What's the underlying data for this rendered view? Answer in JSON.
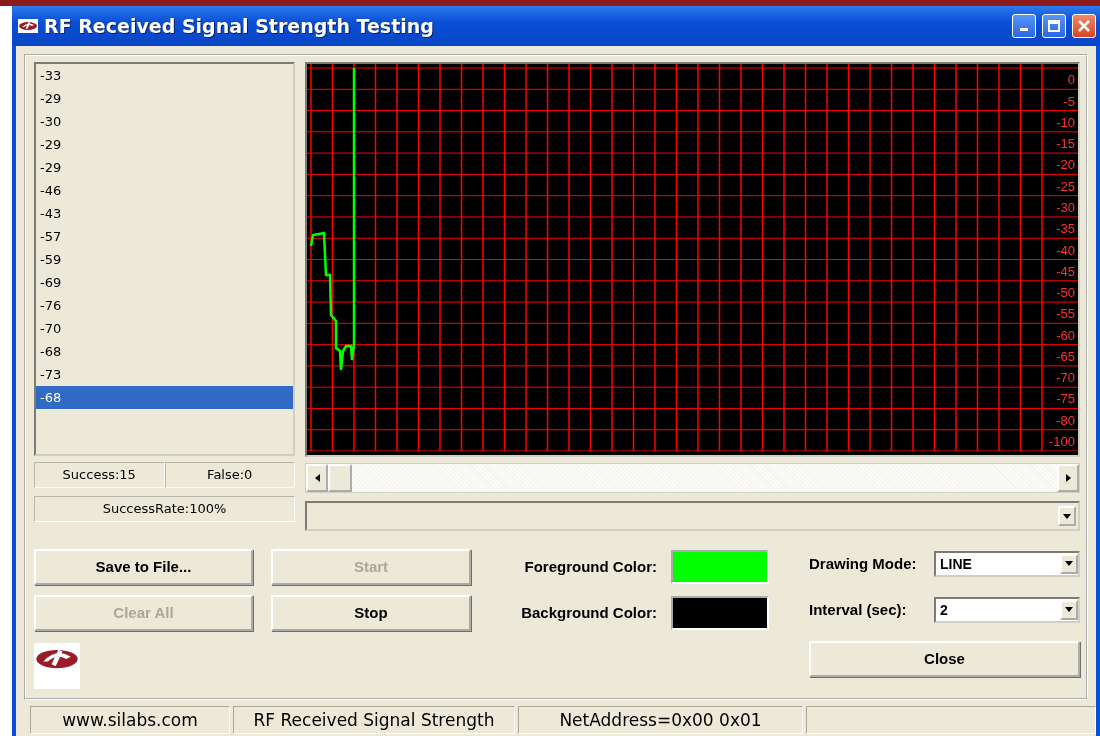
{
  "window": {
    "title": "RF Received Signal Strength Testing"
  },
  "readings": [
    {
      "value": "-33",
      "selected": false
    },
    {
      "value": "-29",
      "selected": false
    },
    {
      "value": "-30",
      "selected": false
    },
    {
      "value": "-29",
      "selected": false
    },
    {
      "value": "-29",
      "selected": false
    },
    {
      "value": "-46",
      "selected": false
    },
    {
      "value": "-43",
      "selected": false
    },
    {
      "value": "-57",
      "selected": false
    },
    {
      "value": "-59",
      "selected": false
    },
    {
      "value": "-69",
      "selected": false
    },
    {
      "value": "-76",
      "selected": false
    },
    {
      "value": "-70",
      "selected": false
    },
    {
      "value": "-68",
      "selected": false
    },
    {
      "value": "-73",
      "selected": false
    },
    {
      "value": "-68",
      "selected": true
    }
  ],
  "counters": {
    "success": "Success:15",
    "false": "False:0",
    "rate": "SuccessRate:100%"
  },
  "graph": {
    "y_labels": [
      "0",
      "-5",
      "-10",
      "-15",
      "-20",
      "-25",
      "-30",
      "-35",
      "-40",
      "-45",
      "-50",
      "-55",
      "-60",
      "-65",
      "-70",
      "-75",
      "-80",
      "-100"
    ]
  },
  "buttons": [
    {
      "label": "Save to File...",
      "disabled": false
    },
    {
      "label": "Start",
      "disabled": true
    },
    {
      "label": "Clear All",
      "disabled": true
    },
    {
      "label": "Stop",
      "disabled": false
    }
  ],
  "colors": [
    {
      "label": "Foreground Color:",
      "color": "#00ff00"
    },
    {
      "label": "Background Color:",
      "color": "#000000"
    }
  ],
  "settings": [
    {
      "label": "Drawing Mode:",
      "value": "LINE"
    },
    {
      "label": "Interval (sec):",
      "value": "2"
    }
  ],
  "close_button": "Close",
  "status_bar": [
    "www.silabs.com",
    "RF Received Signal Strength",
    "NetAddress=0x00 0x01"
  ]
}
